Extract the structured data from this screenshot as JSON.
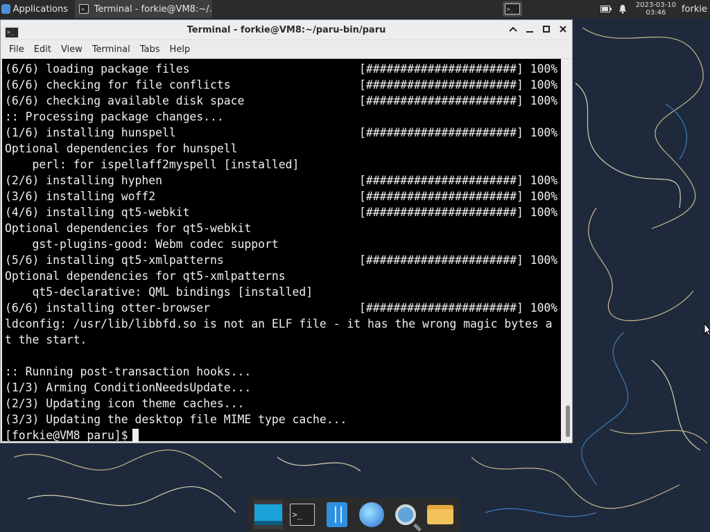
{
  "panel": {
    "apps_label": "Applications",
    "task_terminal_label": "Terminal - forkie@VM8:~/...",
    "clock_date": "2023-03-10",
    "clock_time": "03:46",
    "user": "forkie",
    "icons": [
      "terminal-icon",
      "battery-icon",
      "notification-bell-icon"
    ]
  },
  "window": {
    "title": "Terminal - forkie@VM8:~/paru-bin/paru",
    "menu": [
      "File",
      "Edit",
      "View",
      "Terminal",
      "Tabs",
      "Help"
    ],
    "controls": [
      "▲",
      "▁",
      "□",
      "✕"
    ]
  },
  "terminal": {
    "lines": [
      {
        "text": "(6/6) loading package files",
        "progress": "[######################] 100%"
      },
      {
        "text": "(6/6) checking for file conflicts",
        "progress": "[######################] 100%"
      },
      {
        "text": "(6/6) checking available disk space",
        "progress": "[######################] 100%"
      },
      {
        "text": ":: Processing package changes...",
        "progress": ""
      },
      {
        "text": "(1/6) installing hunspell",
        "progress": "[######################] 100%"
      },
      {
        "text": "Optional dependencies for hunspell",
        "progress": ""
      },
      {
        "text": "    perl: for ispellaff2myspell [installed]",
        "progress": ""
      },
      {
        "text": "(2/6) installing hyphen",
        "progress": "[######################] 100%"
      },
      {
        "text": "(3/6) installing woff2",
        "progress": "[######################] 100%"
      },
      {
        "text": "(4/6) installing qt5-webkit",
        "progress": "[######################] 100%"
      },
      {
        "text": "Optional dependencies for qt5-webkit",
        "progress": ""
      },
      {
        "text": "    gst-plugins-good: Webm codec support",
        "progress": ""
      },
      {
        "text": "(5/6) installing qt5-xmlpatterns",
        "progress": "[######################] 100%"
      },
      {
        "text": "Optional dependencies for qt5-xmlpatterns",
        "progress": ""
      },
      {
        "text": "    qt5-declarative: QML bindings [installed]",
        "progress": ""
      },
      {
        "text": "(6/6) installing otter-browser",
        "progress": "[######################] 100%"
      },
      {
        "text": "ldconfig: /usr/lib/libbfd.so is not an ELF file - it has the wrong magic bytes a",
        "progress": ""
      },
      {
        "text": "t the start.",
        "progress": ""
      },
      {
        "text": "",
        "progress": ""
      },
      {
        "text": ":: Running post-transaction hooks...",
        "progress": ""
      },
      {
        "text": "(1/3) Arming ConditionNeedsUpdate...",
        "progress": ""
      },
      {
        "text": "(2/3) Updating icon theme caches...",
        "progress": ""
      },
      {
        "text": "(3/3) Updating the desktop file MIME type cache...",
        "progress": ""
      }
    ],
    "prompt": "[forkie@VM8 paru]$"
  },
  "dock": {
    "items": [
      "show-desktop-icon",
      "terminal-icon",
      "file-manager-icon",
      "web-browser-icon",
      "search-icon",
      "folder-icon"
    ]
  },
  "colors": {
    "desktop_bg": "#1f2b3d",
    "terminal_bg": "#000000",
    "terminal_fg": "#f0f0f0",
    "panel_bg": "#2b2b2b"
  }
}
